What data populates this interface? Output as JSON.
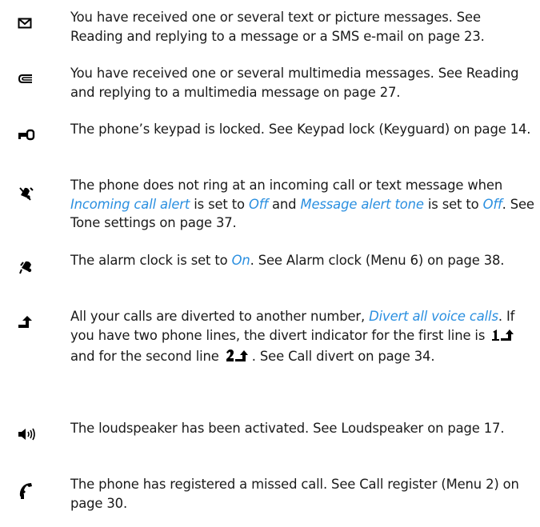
{
  "colors": {
    "text": "#1a1a1a",
    "highlight": "#2a8fe0",
    "icon": "#000000"
  },
  "entries": [
    {
      "icon": "envelope-icon",
      "t0": "You have received one or several text or picture messages. See Reading and replying to a message or a SMS e-mail on page 23."
    },
    {
      "icon": "multimedia-message-icon",
      "t0": "You have received one or several multimedia messages. See Reading and replying to a multimedia message on page 27."
    },
    {
      "icon": "key-lock-icon",
      "t0": "The phone’s keypad is locked. See Keypad lock (Keyguard) on page 14."
    },
    {
      "icon": "silent-bell-icon",
      "t0": "The phone does not ring at an incoming call or text message when ",
      "h1": "Incoming call alert",
      "t1": " is set to ",
      "h2": "Off",
      "t2": " and ",
      "h3": "Message alert tone",
      "t3": " is set to ",
      "h4": "Off",
      "t4": ". See Tone settings on page 37."
    },
    {
      "icon": "alarm-bell-icon",
      "t0": "The alarm clock is set to ",
      "h1": "On",
      "t1": ". See Alarm clock (Menu 6) on page 38."
    },
    {
      "icon": "divert-arrow-icon",
      "t0": "All your calls are diverted to another number, ",
      "h1": "Divert all voice calls",
      "t1": ". If you have two phone lines, the divert indicator for the first line is ",
      "t2": " and for the second line ",
      "t3": ". See Call divert on page 34."
    },
    {
      "icon": "loudspeaker-icon",
      "t0": "The loudspeaker has been activated. See Loudspeaker on page 17."
    },
    {
      "icon": "missed-call-icon",
      "t0": "The phone has registered a missed call. See Call register (Menu 2) on page 30."
    }
  ]
}
